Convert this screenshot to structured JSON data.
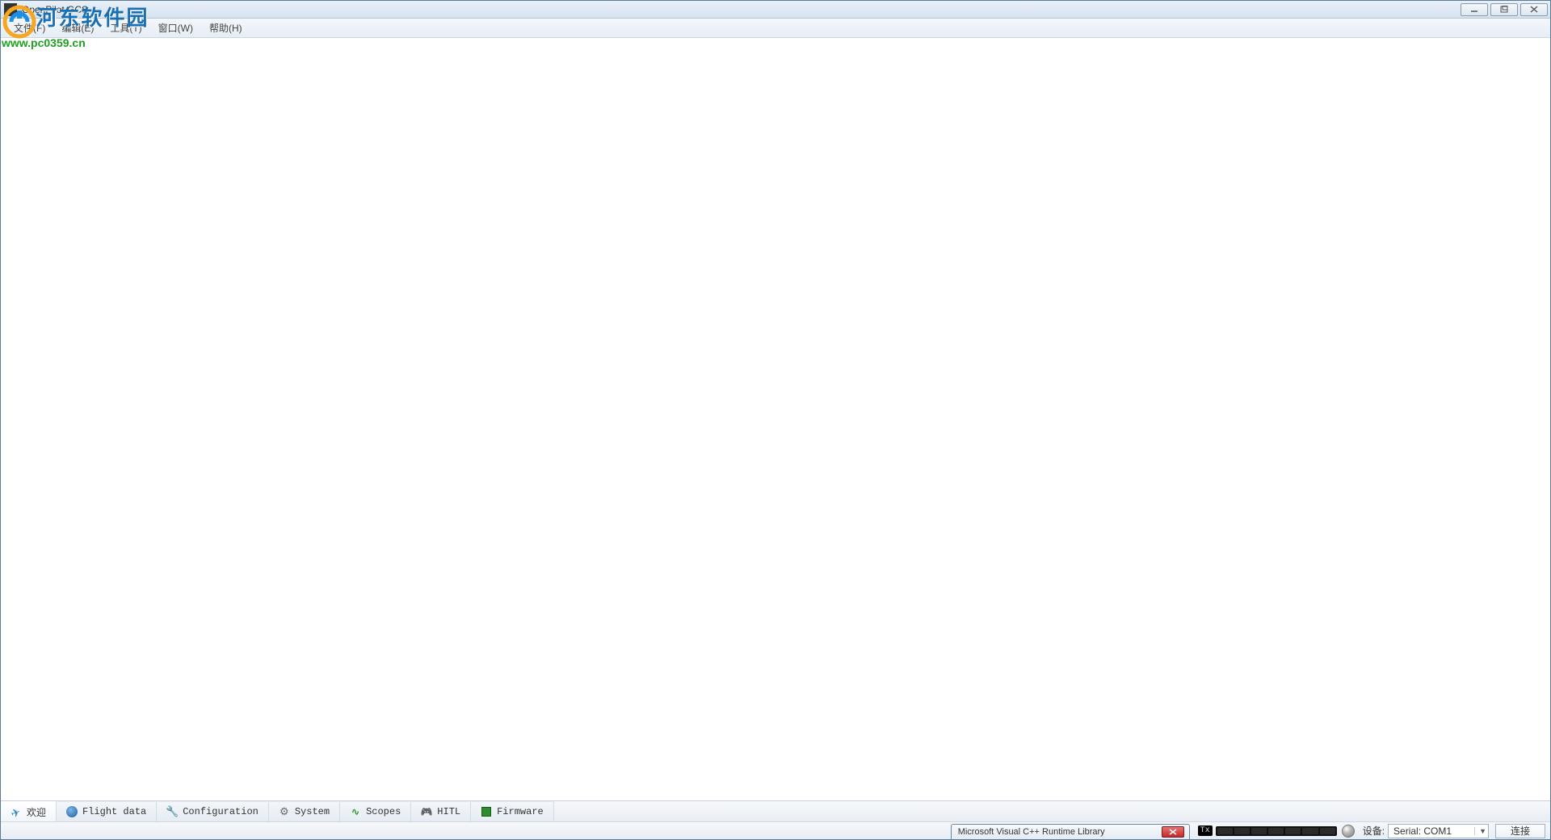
{
  "titlebar": {
    "title": "OpenPilot GCS"
  },
  "menu": {
    "file": "文件(F)",
    "edit": "编辑(E)",
    "tools": "工具(T)",
    "window": "窗口(W)",
    "help": "帮助(H)"
  },
  "watermark": {
    "text_cn": "河东软件园",
    "url": "www.pc0359.cn"
  },
  "tabs": {
    "welcome": "欢迎",
    "flight_data": "Flight data",
    "configuration": "Configuration",
    "system": "System",
    "scopes": "Scopes",
    "hitl": "HITL",
    "firmware": "Firmware"
  },
  "statusbar": {
    "dialog_title": "Microsoft Visual C++ Runtime Library",
    "tx_label": "Tx",
    "device_label": "设备:",
    "device_value": "Serial: COM1",
    "connect_label": "连接"
  }
}
